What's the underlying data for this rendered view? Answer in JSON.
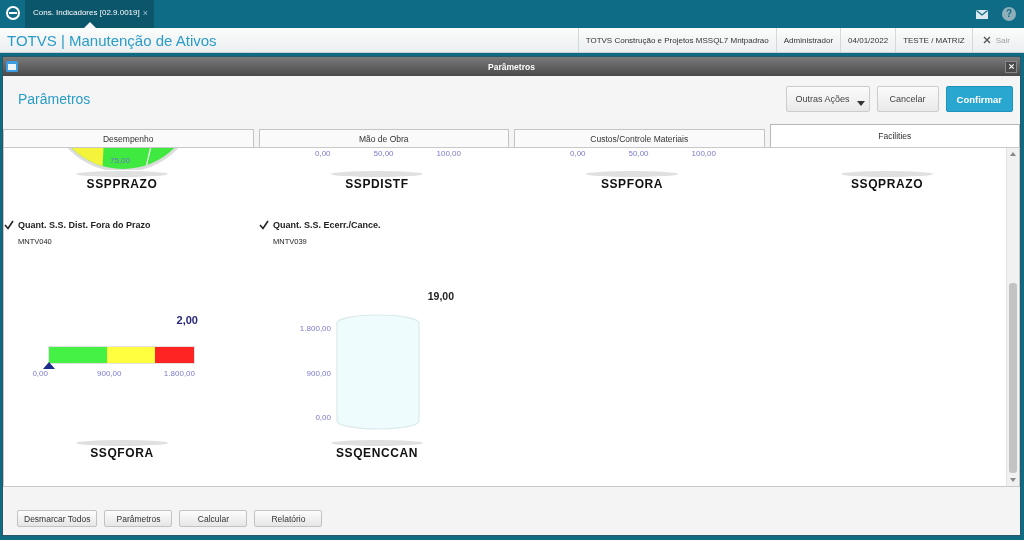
{
  "top_bar": {
    "tabs": [
      {
        "label": "Cons. Indicadores [02.9.0019]",
        "close": "×",
        "selected": true
      }
    ],
    "help": "?"
  },
  "header": {
    "title": "TOTVS | Manutenção de Ativos",
    "info": [
      "TOTVS Construção e Projetos MSSQL7 Mntpadrao",
      "Administrador",
      "04/01/2022",
      "TESTE / MATRIZ"
    ],
    "logout": {
      "label": "Sair",
      "disabled": true
    }
  },
  "dialog": {
    "title": "Parâmetros",
    "heading": "Parâmetros",
    "actions": [
      {
        "label": "Outras Ações",
        "kind": "menu"
      },
      {
        "label": "Cancelar",
        "kind": "default"
      },
      {
        "label": "Confirmar",
        "kind": "primary"
      }
    ],
    "tabs": [
      {
        "label": "Desempenho",
        "selected": false
      },
      {
        "label": "Mão de Obra",
        "selected": false
      },
      {
        "label": "Custos/Controle Materiais",
        "selected": false
      },
      {
        "label": "Facilities",
        "selected": true
      }
    ],
    "indicators": [
      {
        "kind": "dial",
        "name": "SSPPRAZO",
        "scale_label": "75,00"
      },
      {
        "kind": "scale",
        "name": "SSPDISTF",
        "ticks": [
          "0,00",
          "50,00",
          "100,00"
        ]
      },
      {
        "kind": "scale",
        "name": "SSPFORA",
        "ticks": [
          "0,00",
          "50,00",
          "100,00"
        ]
      },
      {
        "kind": "blank",
        "name": "SSQPRAZO"
      },
      {
        "kind": "bar",
        "label": "Quant. S.S. Dist. Fora do Prazo",
        "checked": true,
        "code": "MNTV040",
        "value": "2,00",
        "bands": [
          {
            "color": "#44f144"
          },
          {
            "color": "#ffff40"
          },
          {
            "color": "#ff2424"
          }
        ],
        "ticks": [
          "0,00",
          "900,00",
          "1.800,00"
        ],
        "name": "SSQFORA"
      },
      {
        "kind": "tank",
        "label": "Quant. S.S. Ecerr./Cance.",
        "checked": true,
        "code": "MNTV039",
        "value": "19,00",
        "ticks": [
          "1.800,00",
          "900,00",
          "0,00"
        ],
        "name": "SSQENCCAN"
      }
    ],
    "footer_buttons": [
      "Desmarcar Todos",
      "Parâmetros",
      "Calcular",
      "Relatório"
    ]
  }
}
